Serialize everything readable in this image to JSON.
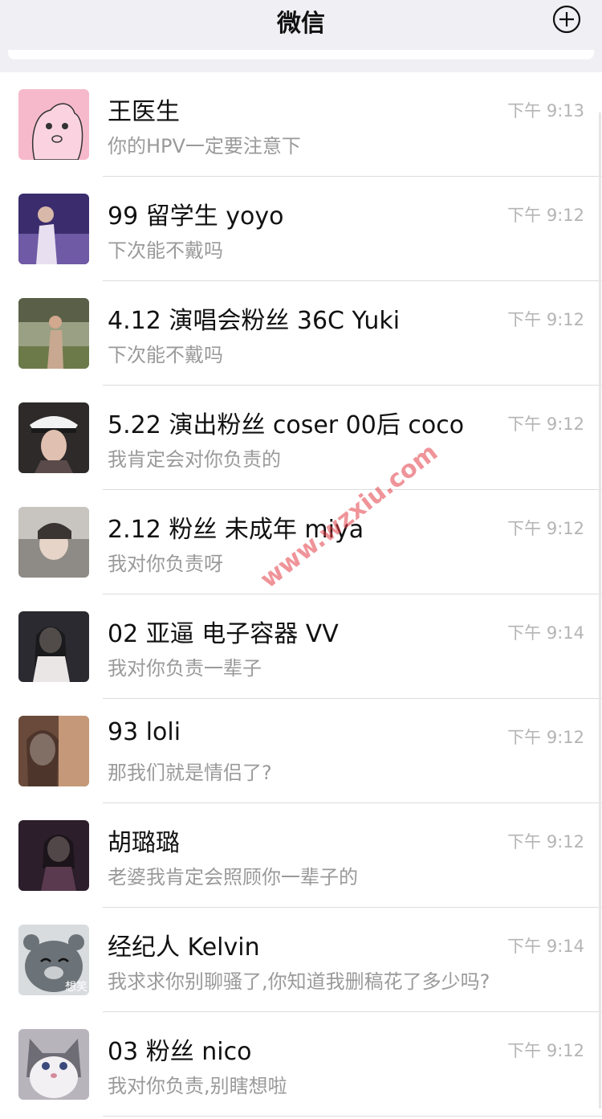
{
  "header": {
    "title": "微信",
    "add_icon": "plus-circle-icon"
  },
  "watermark": "www.wzxiu.com",
  "chats": [
    {
      "name": "王医生",
      "preview": "你的HPV一定要注意下",
      "time": "下午 9:13",
      "avatar": "cartoon-pig-avatar",
      "color": "#f6b9cc"
    },
    {
      "name": "99 留学生 yoyo",
      "preview": "下次能不戴吗",
      "time": "下午 9:12",
      "avatar": "photo-avatar",
      "color": "#6f5aa5"
    },
    {
      "name": "4.12 演唱会粉丝 36C Yuki",
      "preview": " 下次能不戴吗",
      "time": "下午 9:12",
      "avatar": "photo-avatar",
      "color": "#7c8a5a"
    },
    {
      "name": "5.22 演出粉丝 coser 00后 coco",
      "preview": "我肯定会对你负责的",
      "time": "下午 9:12",
      "avatar": "photo-avatar",
      "color": "#4b4242"
    },
    {
      "name": "2.12 粉丝 未成年 miya",
      "preview": "我对你负责呀",
      "time": "下午 9:12",
      "avatar": "photo-avatar",
      "color": "#8e8a86"
    },
    {
      "name": "02 亚逼 电子容器 VV",
      "preview": "我对你负责一辈子",
      "time": "下午 9:14",
      "avatar": "photo-avatar",
      "color": "#3a3a40"
    },
    {
      "name": "93 loli",
      "preview": "那我们就是情侣了?",
      "time": "下午 9:12",
      "avatar": "photo-avatar",
      "color": "#a07a64"
    },
    {
      "name": "胡璐璐",
      "preview": "老婆我肯定会照顾你一辈子的",
      "time": "下午 9:12",
      "avatar": "photo-avatar",
      "color": "#4a3a48"
    },
    {
      "name": "经纪人 Kelvin",
      "preview": "我求求你别聊骚了,你知道我删稿花了多少吗?",
      "time": "下午 9:14",
      "avatar": "cartoon-bear-avatar",
      "color": "#6c7378",
      "avatar_text": "想笑"
    },
    {
      "name": "03 粉丝 nico",
      "preview": "我对你负责,别瞎想啦",
      "time": "下午 9:12",
      "avatar": "cat-photo-avatar",
      "color": "#8c8a92"
    }
  ]
}
